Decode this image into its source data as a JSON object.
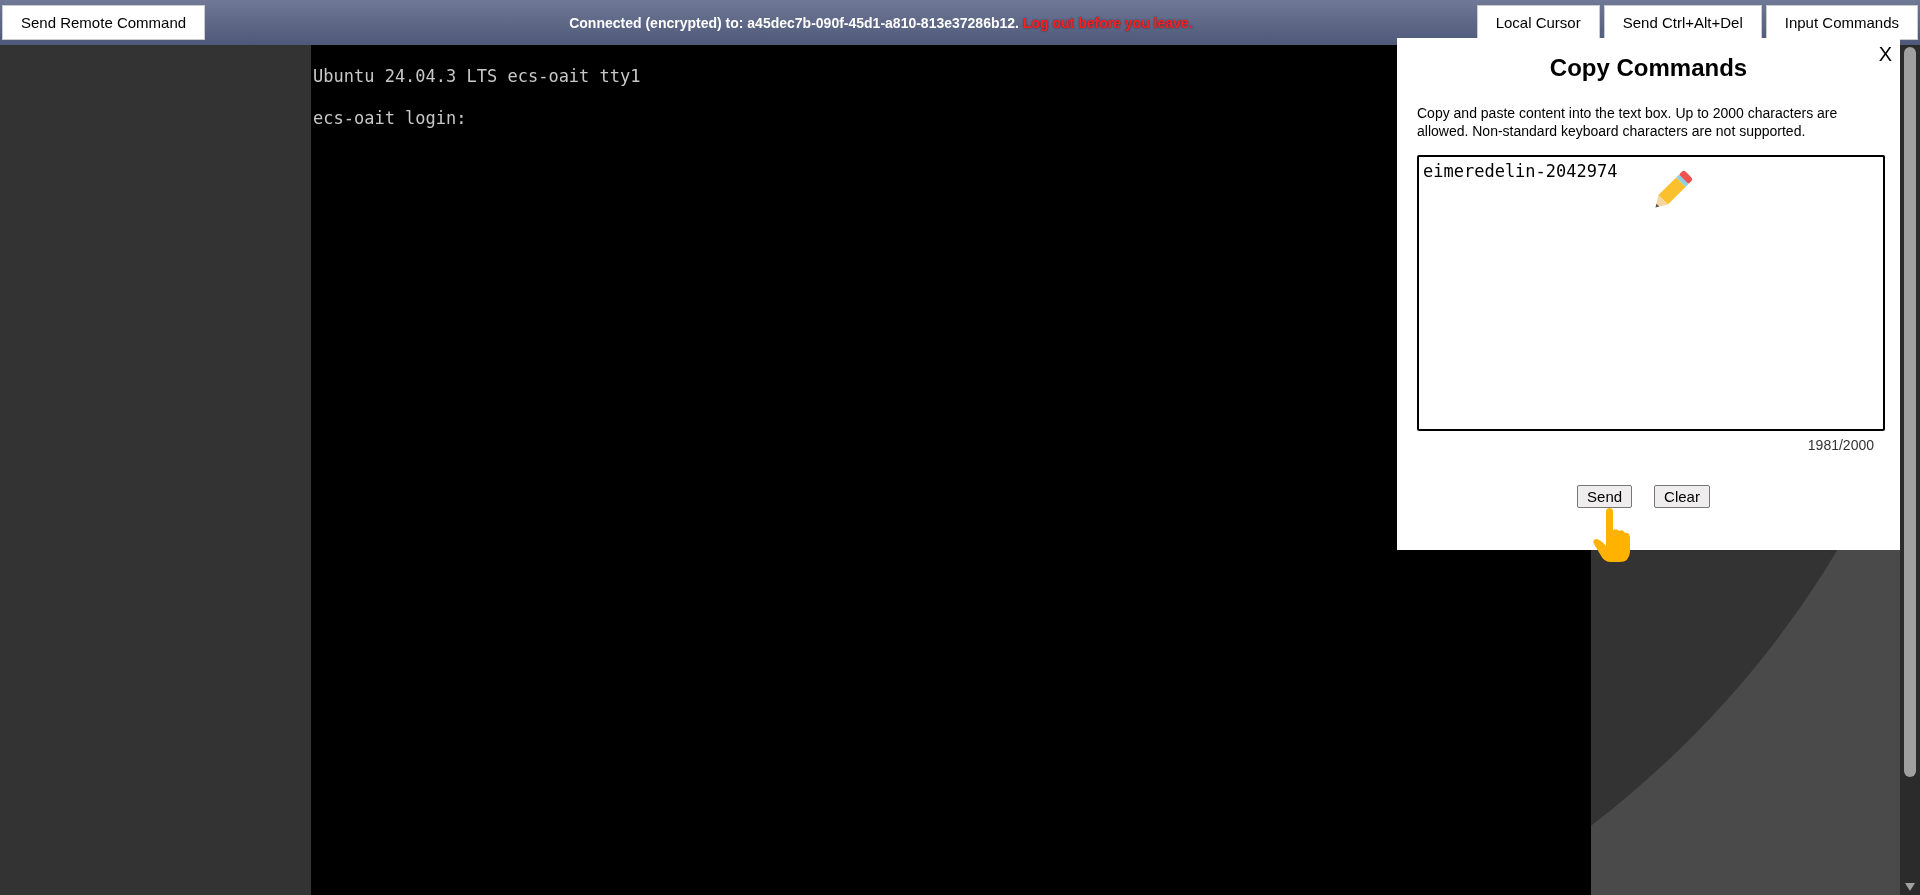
{
  "toolbar": {
    "left_button": "Send Remote Command",
    "status": "Connected (encrypted) to: a45dec7b-090f-45d1-a810-813e37286b12.",
    "warning": "Log out before you leave.",
    "right_buttons": [
      "Local Cursor",
      "Send Ctrl+Alt+Del",
      "Input Commands"
    ]
  },
  "terminal": {
    "lines": [
      "Ubuntu 24.04.3 LTS ecs-oait tty1",
      "ecs-oait login:"
    ]
  },
  "dialog": {
    "title": "Copy Commands",
    "close": "X",
    "description": "Copy and paste content into the text box. Up to 2000 characters are allowed. Non-standard keyboard characters are not supported.",
    "value": "eimeredelin-2042974",
    "counter": "1981/2000",
    "buttons": [
      "Send",
      "Clear"
    ]
  }
}
